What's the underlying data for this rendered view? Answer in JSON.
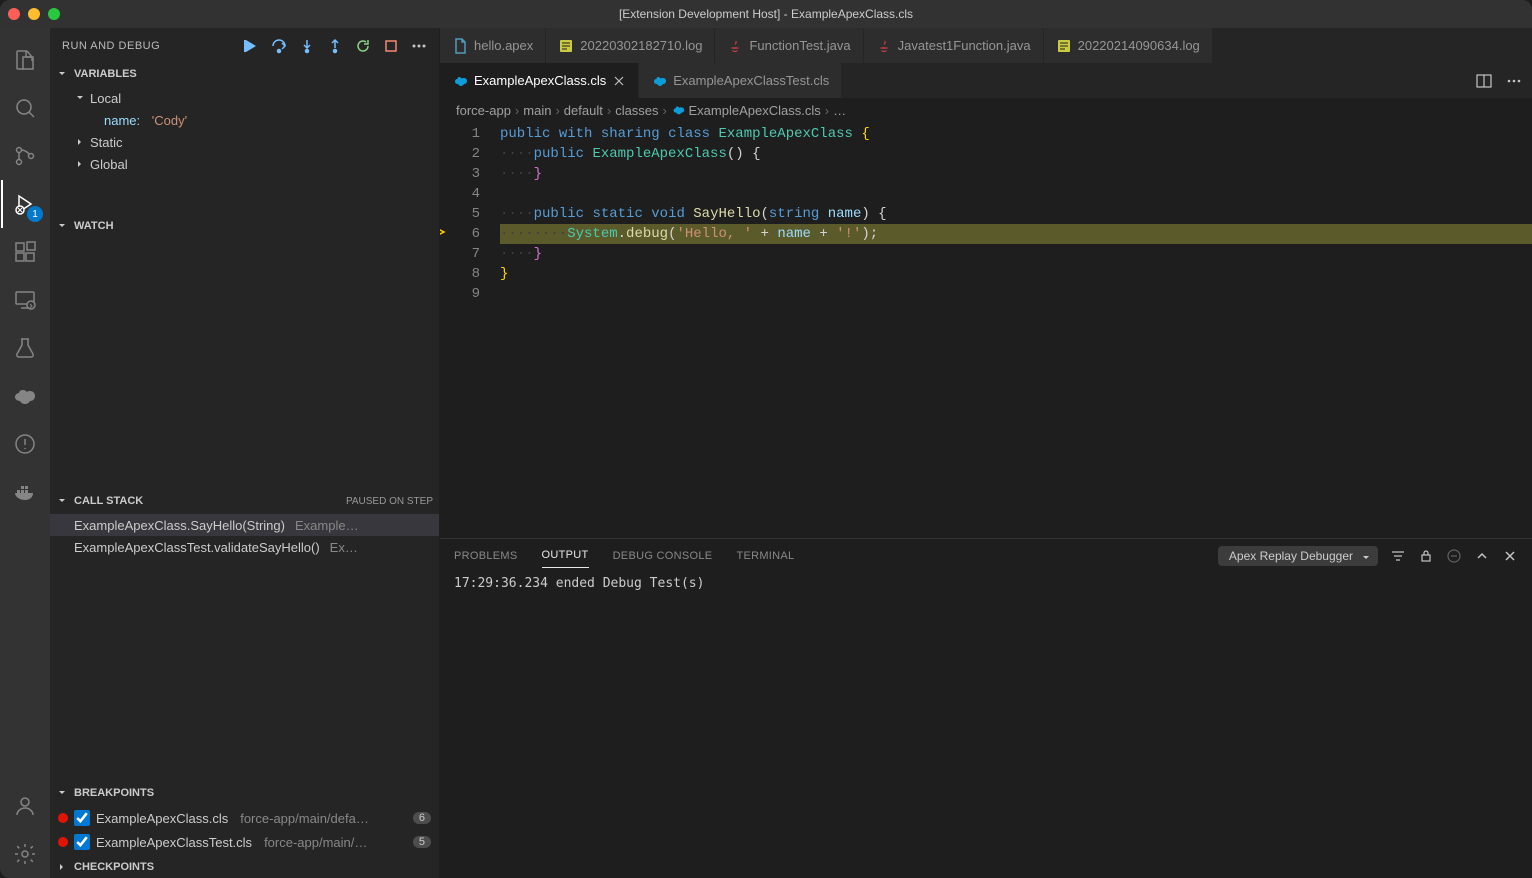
{
  "window": {
    "title": "[Extension Development Host] - ExampleApexClass.cls"
  },
  "activitybar": {
    "debugBadge": "1"
  },
  "sidebar": {
    "title": "RUN AND DEBUG",
    "sections": {
      "variables": {
        "label": "VARIABLES",
        "scopes": [
          {
            "name": "Local",
            "expanded": true,
            "vars": [
              {
                "name": "name:",
                "value": "'Cody'"
              }
            ]
          },
          {
            "name": "Static",
            "expanded": false
          },
          {
            "name": "Global",
            "expanded": false
          }
        ]
      },
      "watch": {
        "label": "WATCH"
      },
      "callstack": {
        "label": "CALL STACK",
        "status": "PAUSED ON STEP",
        "frames": [
          {
            "method": "ExampleApexClass.SayHello(String)",
            "location": "Example…",
            "selected": true
          },
          {
            "method": "ExampleApexClassTest.validateSayHello()",
            "location": "Ex…",
            "selected": false
          }
        ]
      },
      "breakpoints": {
        "label": "BREAKPOINTS",
        "items": [
          {
            "file": "ExampleApexClass.cls",
            "path": "force-app/main/defa…",
            "count": "6",
            "checked": true
          },
          {
            "file": "ExampleApexClassTest.cls",
            "path": "force-app/main/…",
            "count": "5",
            "checked": true
          }
        ]
      },
      "checkpoints": {
        "label": "CHECKPOINTS"
      }
    }
  },
  "tabsRow1": [
    {
      "name": "hello.apex",
      "iconColor": "#519aba",
      "iconType": "file"
    },
    {
      "name": "20220302182710.log",
      "iconColor": "#cbcb41",
      "iconType": "log"
    },
    {
      "name": "FunctionTest.java",
      "iconColor": "#cc3e44",
      "iconType": "java"
    },
    {
      "name": "Javatest1Function.java",
      "iconColor": "#cc3e44",
      "iconType": "java"
    },
    {
      "name": "20220214090634.log",
      "iconColor": "#cbcb41",
      "iconType": "log"
    }
  ],
  "tabsRow2": [
    {
      "name": "ExampleApexClass.cls",
      "active": true,
      "closeVisible": true
    },
    {
      "name": "ExampleApexClassTest.cls",
      "active": false,
      "closeVisible": false
    }
  ],
  "breadcrumb": [
    "force-app",
    "main",
    "default",
    "classes",
    "ExampleApexClass.cls",
    "…"
  ],
  "code": {
    "currentLine": 6,
    "lines": [
      [
        {
          "t": "kw",
          "v": "public"
        },
        {
          "t": "sp"
        },
        {
          "t": "kw",
          "v": "with"
        },
        {
          "t": "sp"
        },
        {
          "t": "kw",
          "v": "sharing"
        },
        {
          "t": "sp"
        },
        {
          "t": "kw",
          "v": "class"
        },
        {
          "t": "sp"
        },
        {
          "t": "type",
          "v": "ExampleApexClass"
        },
        {
          "t": "sp"
        },
        {
          "t": "brace",
          "v": "{"
        }
      ],
      [
        {
          "t": "ws",
          "v": "····"
        },
        {
          "t": "kw",
          "v": "public"
        },
        {
          "t": "sp"
        },
        {
          "t": "type",
          "v": "ExampleApexClass"
        },
        {
          "t": "punc",
          "v": "()"
        },
        {
          "t": "sp"
        },
        {
          "t": "punc",
          "v": "{"
        }
      ],
      [
        {
          "t": "ws",
          "v": "····"
        },
        {
          "t": "brace2",
          "v": "}"
        }
      ],
      [],
      [
        {
          "t": "ws",
          "v": "····"
        },
        {
          "t": "kw",
          "v": "public"
        },
        {
          "t": "sp"
        },
        {
          "t": "kw",
          "v": "static"
        },
        {
          "t": "sp"
        },
        {
          "t": "kw",
          "v": "void"
        },
        {
          "t": "sp"
        },
        {
          "t": "fn",
          "v": "SayHello"
        },
        {
          "t": "punc",
          "v": "("
        },
        {
          "t": "kw",
          "v": "string"
        },
        {
          "t": "sp"
        },
        {
          "t": "param",
          "v": "name"
        },
        {
          "t": "punc",
          "v": ")"
        },
        {
          "t": "sp"
        },
        {
          "t": "punc",
          "v": "{"
        }
      ],
      [
        {
          "t": "ws",
          "v": "········"
        },
        {
          "t": "type",
          "v": "System"
        },
        {
          "t": "punc",
          "v": "."
        },
        {
          "t": "fn",
          "v": "debug"
        },
        {
          "t": "punc",
          "v": "("
        },
        {
          "t": "str",
          "v": "'Hello, '"
        },
        {
          "t": "sp"
        },
        {
          "t": "punc",
          "v": "+"
        },
        {
          "t": "sp"
        },
        {
          "t": "param",
          "v": "name"
        },
        {
          "t": "sp"
        },
        {
          "t": "punc",
          "v": "+"
        },
        {
          "t": "sp"
        },
        {
          "t": "str",
          "v": "'!'"
        },
        {
          "t": "punc",
          "v": ");"
        }
      ],
      [
        {
          "t": "ws",
          "v": "····"
        },
        {
          "t": "brace2",
          "v": "}"
        }
      ],
      [
        {
          "t": "brace",
          "v": "}"
        }
      ],
      []
    ]
  },
  "panel": {
    "tabs": [
      "PROBLEMS",
      "OUTPUT",
      "DEBUG CONSOLE",
      "TERMINAL"
    ],
    "activeTab": "OUTPUT",
    "selector": "Apex Replay Debugger",
    "output": "17:29:36.234 ended Debug Test(s)"
  }
}
